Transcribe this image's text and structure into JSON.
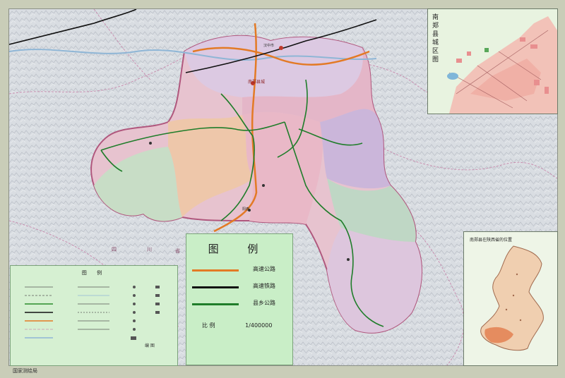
{
  "map": {
    "main_city_label": "南郑县城",
    "city_labels": [
      "汉中市",
      "阳春"
    ],
    "region_labels": [
      "四",
      "川",
      "省"
    ]
  },
  "legend": {
    "title": "图 例",
    "items": [
      {
        "label": "高速公路",
        "color": "#e37a25"
      },
      {
        "label": "高速铁路",
        "color": "#111111"
      },
      {
        "label": "县乡公路",
        "color": "#1f7d2a"
      }
    ],
    "scale_label": "比 例",
    "scale_value": "1/400000"
  },
  "legend_small": {
    "title": "图 例",
    "title2": "编 图"
  },
  "inset_city": {
    "title": "南郑县城区图"
  },
  "inset_location": {
    "title": "南郑县在陕西省的位置"
  },
  "footer": {
    "credit": "国家测绘局"
  },
  "colors": {
    "county_pink": "#e9b8c7",
    "county_purple": "#c9b2d8",
    "county_peach": "#f0c8a8",
    "county_green": "#bfdcc8",
    "terrain": "#d7dbe0",
    "legend_bg": "#c9eec7"
  }
}
